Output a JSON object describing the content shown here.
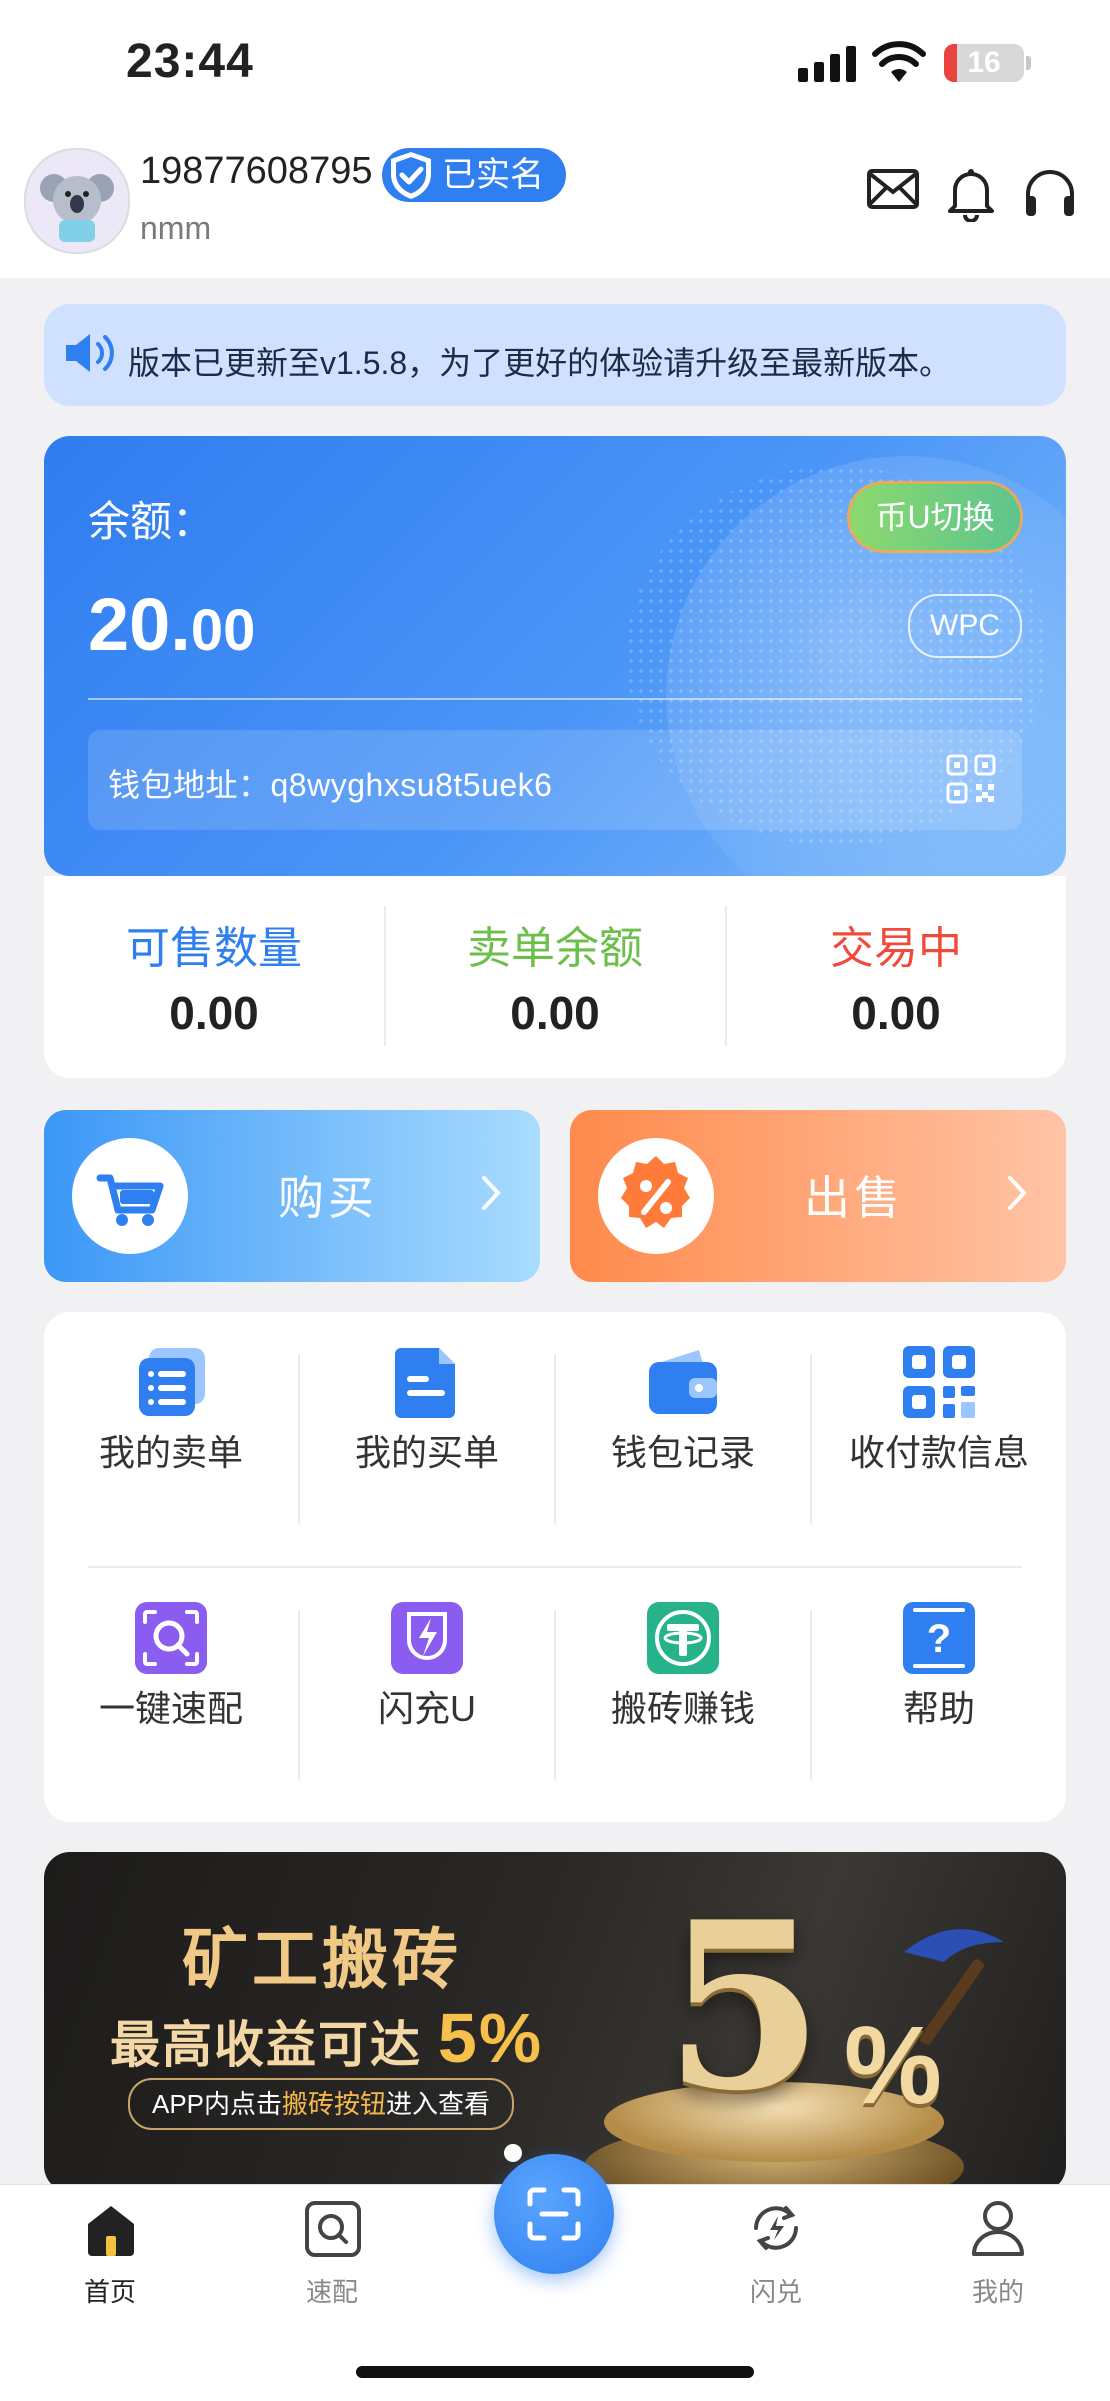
{
  "status_bar": {
    "time": "23:44",
    "battery": "16",
    "battery_level_percent": 16
  },
  "user": {
    "phone": "19877608795",
    "verified_label": "已实名",
    "nickname": "nmm"
  },
  "header_icons": [
    "mail-icon",
    "bell-icon",
    "headset-icon"
  ],
  "notice": {
    "text": "版本已更新至v1.5.8，为了更好的体验请升级至最新版本。"
  },
  "balance_card": {
    "label": "余额：",
    "amount_int": "20.",
    "amount_dec": "00",
    "switch_label": "币U切换",
    "currency": "WPC",
    "address_label": "钱包地址：q8wyghxsu8t5uek6"
  },
  "stats": [
    {
      "label": "可售数量",
      "value": "0.00",
      "color": "#2f7ff0"
    },
    {
      "label": "卖单余额",
      "value": "0.00",
      "color": "#6cc04a"
    },
    {
      "label": "交易中",
      "value": "0.00",
      "color": "#f04a3a"
    }
  ],
  "actions": {
    "buy": "购买",
    "sell": "出售"
  },
  "grid": [
    {
      "label": "我的卖单",
      "icon": "sell-orders-icon"
    },
    {
      "label": "我的买单",
      "icon": "buy-orders-icon"
    },
    {
      "label": "钱包记录",
      "icon": "wallet-icon"
    },
    {
      "label": "收付款信息",
      "icon": "qr-code-icon"
    },
    {
      "label": "一键速配",
      "icon": "quick-match-icon"
    },
    {
      "label": "闪充U",
      "icon": "flash-charge-icon"
    },
    {
      "label": "搬砖赚钱",
      "icon": "tether-icon"
    },
    {
      "label": "帮助",
      "icon": "help-icon"
    }
  ],
  "banner": {
    "title": "矿工搬砖",
    "subtitle": "最高收益可达",
    "percent": "5%",
    "pill_pre": "APP内点击",
    "pill_hl": "搬砖按钮",
    "pill_post": "进入查看",
    "big_five": "5",
    "big_pct": "%"
  },
  "tabs": [
    {
      "label": "首页",
      "icon": "home-icon",
      "active": true
    },
    {
      "label": "速配",
      "icon": "search-match-icon",
      "active": false
    },
    {
      "label": "",
      "icon": "scan-icon",
      "active": false
    },
    {
      "label": "闪兑",
      "icon": "exchange-icon",
      "active": false
    },
    {
      "label": "我的",
      "icon": "profile-icon",
      "active": false
    }
  ]
}
